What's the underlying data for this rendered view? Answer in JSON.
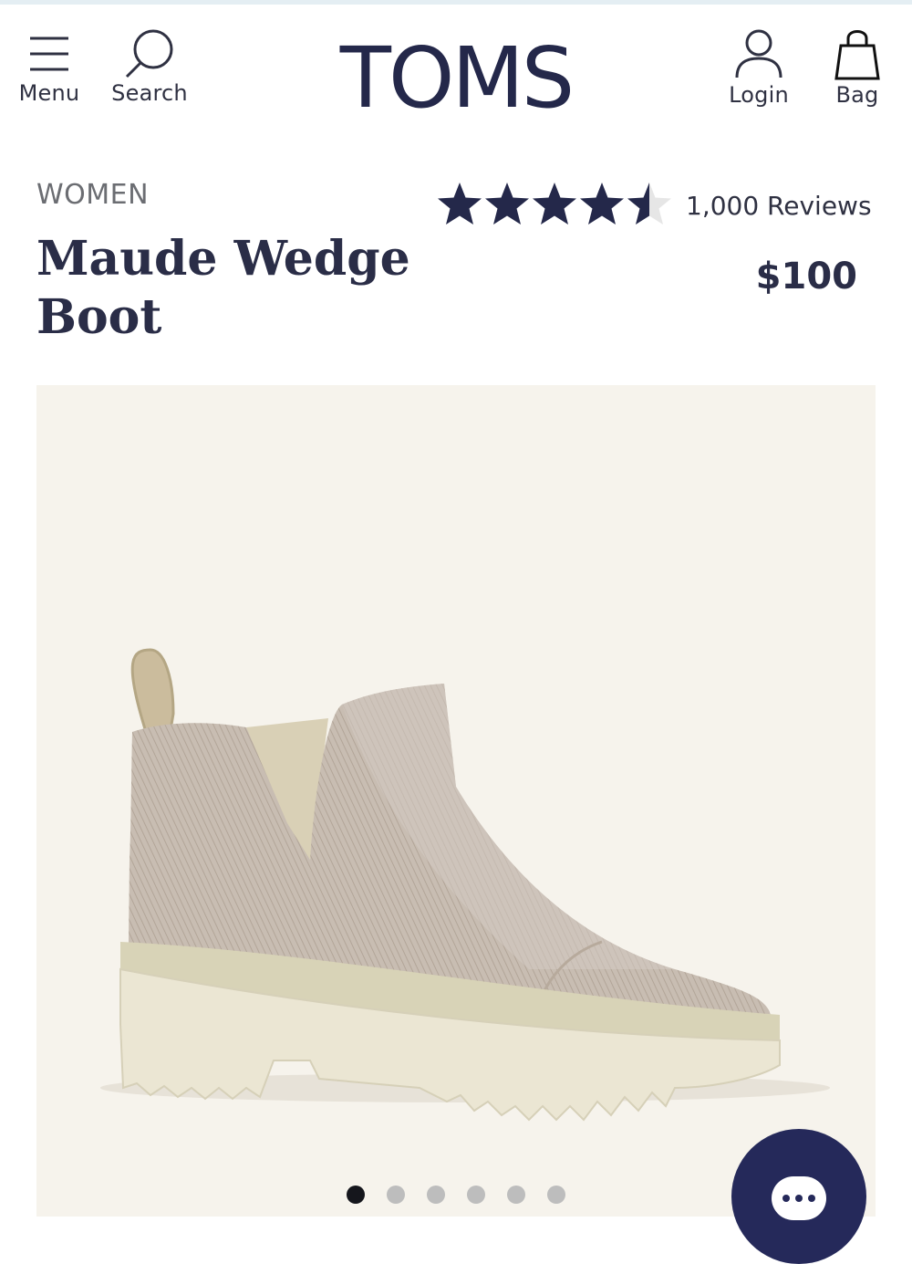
{
  "header": {
    "menu_label": "Menu",
    "search_label": "Search",
    "logo_text": "TOMS",
    "login_label": "Login",
    "bag_label": "Bag"
  },
  "product": {
    "category": "WOMEN",
    "title": "Maude Wedge Boot",
    "rating": 4.5,
    "rating_max": 5,
    "reviews_text": "1,000 Reviews",
    "price": "$100"
  },
  "gallery": {
    "image_count": 6,
    "active_index": 0
  },
  "colors": {
    "brand_navy": "#24284a",
    "gallery_bg": "#f6f3ec",
    "chat_button": "#25295a",
    "dot_active": "#15161c",
    "dot_inactive": "#bdbdbd"
  },
  "icons": [
    "menu-icon",
    "search-icon",
    "user-icon",
    "bag-icon",
    "star-icon",
    "chat-icon"
  ]
}
